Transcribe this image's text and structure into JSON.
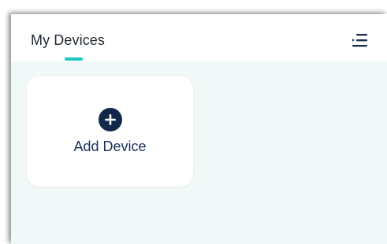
{
  "header": {
    "title": "My Devices",
    "menu_icon": "menu-list-icon"
  },
  "devices": {
    "add_label": "Add Device",
    "add_icon": "plus-circle-icon"
  },
  "colors": {
    "accent": "#1cc8c0",
    "primary": "#11284a",
    "background": "#f1f8f8"
  }
}
